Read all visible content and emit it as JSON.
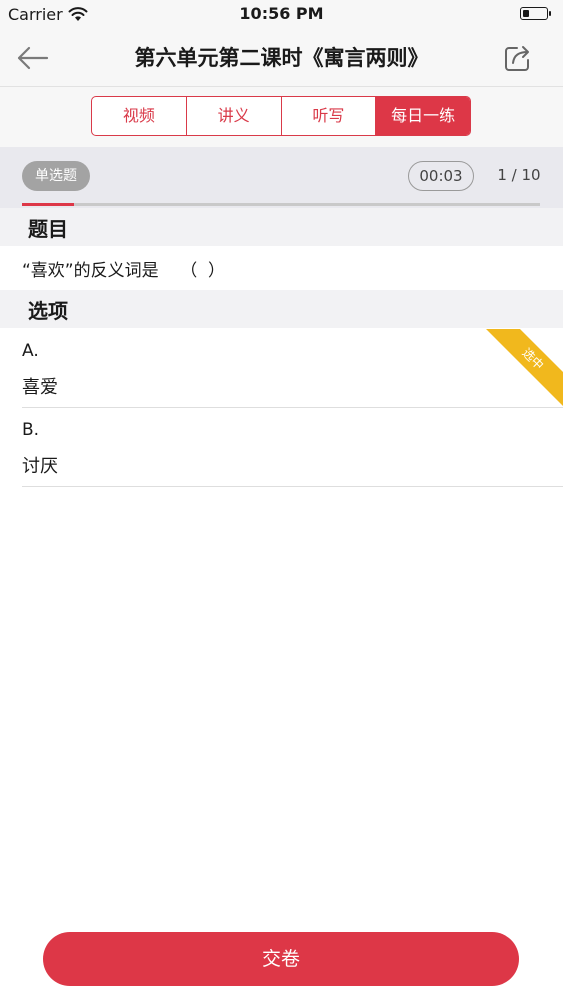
{
  "status_bar": {
    "carrier": "Carrier",
    "time": "10:56 PM"
  },
  "nav": {
    "title": "第六单元第二课时《寓言两则》",
    "back_icon": "arrow-left-icon",
    "share_icon": "share-icon"
  },
  "tabs": [
    {
      "label": "视频",
      "active": false
    },
    {
      "label": "讲义",
      "active": false
    },
    {
      "label": "听写",
      "active": false
    },
    {
      "label": "每日一练",
      "active": true
    }
  ],
  "question_header": {
    "type_label": "单选题",
    "timer": "00:03",
    "progress": "1 / 10",
    "progress_fraction": 0.1
  },
  "sections": {
    "question_title": "题目",
    "options_title": "选项"
  },
  "question": {
    "text": "“喜欢”的反义词是    （  ）"
  },
  "options": [
    {
      "letter": "A.",
      "text": "喜爱",
      "selected": true,
      "selected_label": "选中"
    },
    {
      "letter": "B.",
      "text": "讨厌",
      "selected": false,
      "selected_label": ""
    }
  ],
  "submit_label": "交卷",
  "colors": {
    "accent": "#dd3747",
    "ribbon": "#f1b81d",
    "badge_gray": "#a3a3a3"
  }
}
